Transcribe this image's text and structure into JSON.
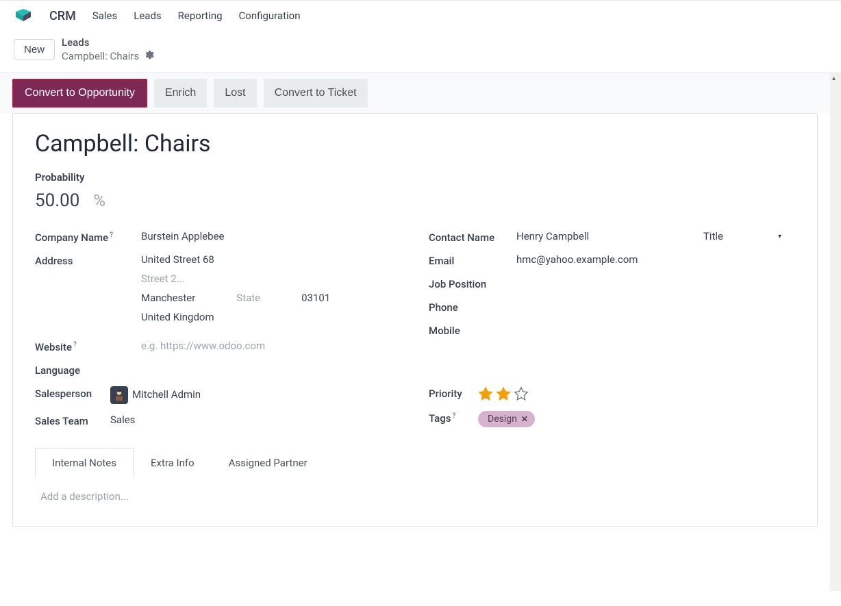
{
  "nav": {
    "app_name": "CRM",
    "items": [
      "Sales",
      "Leads",
      "Reporting",
      "Configuration"
    ]
  },
  "breadcrumb": {
    "new_label": "New",
    "parent": "Leads",
    "current": "Campbell: Chairs"
  },
  "actions": {
    "convert_opportunity": "Convert to Opportunity",
    "enrich": "Enrich",
    "lost": "Lost",
    "convert_ticket": "Convert to Ticket"
  },
  "record": {
    "title": "Campbell: Chairs",
    "probability_label": "Probability",
    "probability_value": "50.00",
    "probability_unit": "%"
  },
  "left_fields": {
    "company_name_label": "Company Name",
    "company_name_value": "Burstein Applebee",
    "address_label": "Address",
    "street1": "United Street 68",
    "street2_placeholder": "Street 2...",
    "city": "Manchester",
    "state_placeholder": "State",
    "zip": "03101",
    "country": "United Kingdom",
    "website_label": "Website",
    "website_placeholder": "e.g. https://www.odoo.com",
    "language_label": "Language",
    "salesperson_label": "Salesperson",
    "salesperson_value": "Mitchell Admin",
    "salesteam_label": "Sales Team",
    "salesteam_value": "Sales"
  },
  "right_fields": {
    "contact_name_label": "Contact Name",
    "contact_name_value": "Henry Campbell",
    "title_placeholder": "Title",
    "email_label": "Email",
    "email_value": "hmc@yahoo.example.com",
    "job_position_label": "Job Position",
    "phone_label": "Phone",
    "mobile_label": "Mobile",
    "priority_label": "Priority",
    "priority_stars": 2,
    "tags_label": "Tags",
    "tag_value": "Design"
  },
  "tabs": {
    "internal_notes": "Internal Notes",
    "extra_info": "Extra Info",
    "assigned_partner": "Assigned Partner",
    "description_placeholder": "Add a description..."
  }
}
